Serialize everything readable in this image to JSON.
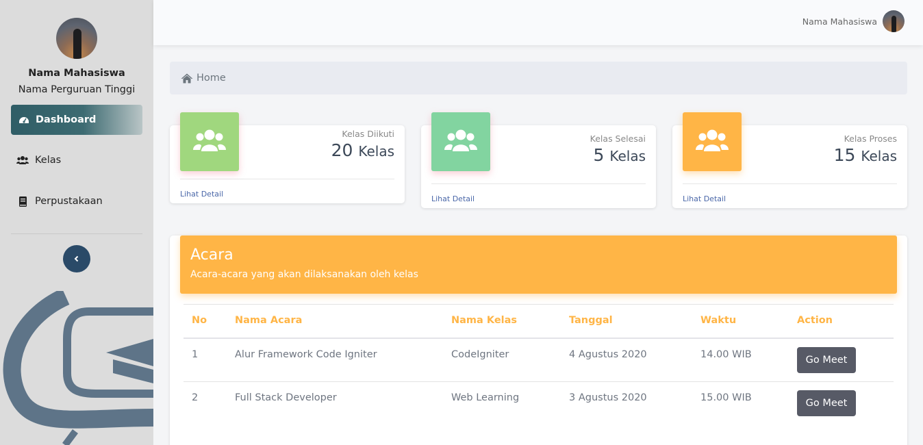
{
  "sidebar": {
    "user_name": "Nama Mahasiswa",
    "university": "Nama Perguruan Tinggi",
    "nav": [
      {
        "label": "Dashboard",
        "icon": "tachometer-icon",
        "active": true
      },
      {
        "label": "Kelas",
        "icon": "users-icon",
        "active": false
      },
      {
        "label": "Perpustakaan",
        "icon": "book-icon",
        "active": false
      }
    ],
    "collapse_icon": "chevron-left-icon"
  },
  "topbar": {
    "user_name": "Nama Mahasiswa"
  },
  "breadcrumb": {
    "icon": "home-icon",
    "label": "Home"
  },
  "stats": [
    {
      "caption": "Kelas Diikuti",
      "value": "20",
      "unit": "Kelas",
      "link": "Lihat Detail",
      "color": "#a0d77e",
      "icon": "users-icon"
    },
    {
      "caption": "Kelas Selesai",
      "value": "5",
      "unit": "Kelas",
      "link": "Lihat Detail",
      "color": "#82d4a0",
      "icon": "users-icon"
    },
    {
      "caption": "Kelas Proses",
      "value": "15",
      "unit": "Kelas",
      "link": "Lihat Detail",
      "color": "#ffb546",
      "icon": "users-icon"
    }
  ],
  "acara": {
    "title": "Acara",
    "subtitle": "Acara-acara yang akan dilaksanakan oleh kelas",
    "header_color": "#ffb546",
    "columns": [
      "No",
      "Nama Acara",
      "Nama Kelas",
      "Tanggal",
      "Waktu",
      "Action"
    ],
    "rows": [
      {
        "no": "1",
        "nama_acara": "Alur Framework Code Igniter",
        "nama_kelas": "CodeIgniter",
        "tanggal": "4 Agustus 2020",
        "waktu": "14.00 WIB",
        "action": "Go Meet"
      },
      {
        "no": "2",
        "nama_acara": "Full Stack Developer",
        "nama_kelas": "Web Learning",
        "tanggal": "3 Agustus 2020",
        "waktu": "15.00 WIB",
        "action": "Go Meet"
      }
    ]
  }
}
